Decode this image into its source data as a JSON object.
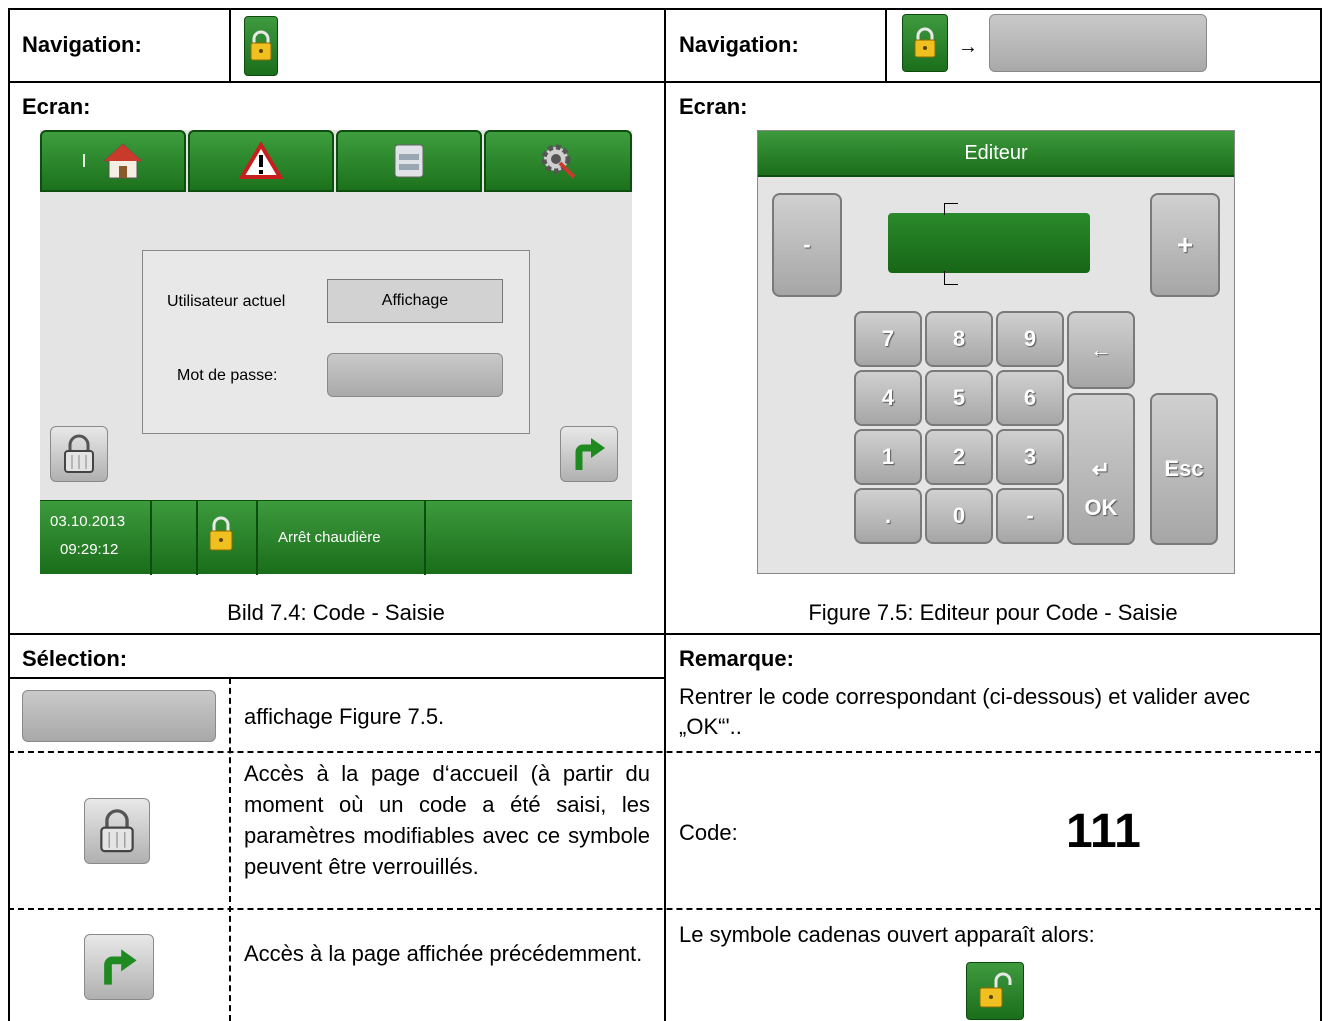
{
  "left": {
    "nav_label": "Navigation:",
    "screen_label": "Ecran:",
    "device": {
      "current_user_label": "Utilisateur actuel",
      "current_user_value": "Affichage",
      "password_label": "Mot de passe:",
      "date": "03.10.2013",
      "time": "09:29:12",
      "status": "Arrêt chaudière",
      "tab1_marker": "I"
    },
    "caption": "Bild 7.4: Code - Saisie"
  },
  "right": {
    "nav_label": "Navigation:",
    "nav_arrow": "→",
    "screen_label": "Ecran:",
    "editor": {
      "title": "Editeur",
      "minus": "-",
      "plus": "+",
      "keys": [
        "7",
        "8",
        "9",
        "4",
        "5",
        "6",
        "1",
        "2",
        "3",
        ".",
        "0",
        "-"
      ],
      "back": "←",
      "enter": "↵",
      "ok": "OK",
      "esc": "Esc"
    },
    "caption": "Figure 7.5: Editeur pour Code - Saisie"
  },
  "selection": {
    "heading": "Sélection:",
    "rows": [
      {
        "text": "affichage Figure 7.5."
      },
      {
        "text": "Accès à la page d‘accueil (à partir du moment où un code a été saisi, les paramètres modifiables avec ce symbole peuvent être verrouillés."
      },
      {
        "text": "Accès à la page affichée précédemment."
      }
    ]
  },
  "remark": {
    "heading": "Remarque:",
    "intro": "Rentrer le code correspondant (ci-dessous) et valider avec „OK“'..",
    "code_label": "Code:",
    "code_value": "111",
    "unlock_text": "Le symbole cadenas ouvert apparaît alors:"
  },
  "colors": {
    "green": "#1f7a1f",
    "gray": "#b5b5b5"
  }
}
